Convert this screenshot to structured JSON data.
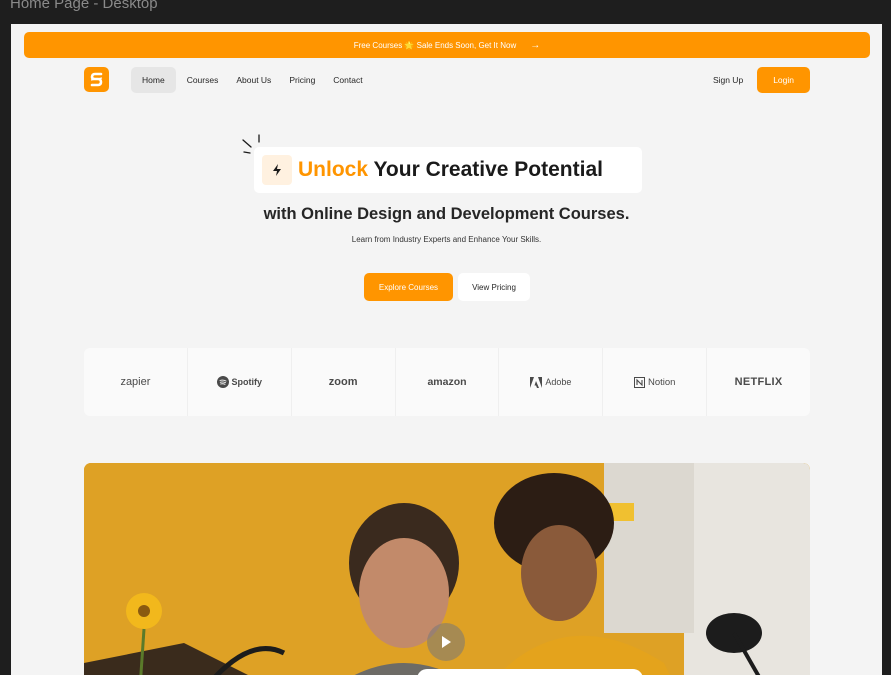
{
  "frame": {
    "title": "Home Page - Desktop"
  },
  "banner": {
    "text": "Free Courses 🌟 Sale Ends Soon, Get It Now",
    "arrow": "→"
  },
  "nav": {
    "links": [
      {
        "label": "Home",
        "active": true
      },
      {
        "label": "Courses",
        "active": false
      },
      {
        "label": "About Us",
        "active": false
      },
      {
        "label": "Pricing",
        "active": false
      },
      {
        "label": "Contact",
        "active": false
      }
    ],
    "signup": "Sign Up",
    "login": "Login"
  },
  "hero": {
    "title_accent": "Unlock",
    "title_rest": " Your Creative Potential",
    "subtitle": "with Online Design and Development Courses.",
    "tagline": "Learn from Industry Experts and Enhance Your Skills.",
    "primary_button": "Explore Courses",
    "secondary_button": "View Pricing"
  },
  "partners": [
    "zapier",
    "Spotify",
    "zoom",
    "amazon",
    "Adobe",
    "Notion",
    "NETFLIX"
  ],
  "colors": {
    "accent": "#ff9500",
    "page_bg": "#f4f4f4",
    "canvas_bg": "#1e1e1e"
  },
  "icons": {
    "logo": "s-logo-icon",
    "bolt": "lightning-icon",
    "arrow": "arrow-right-icon",
    "play": "play-icon"
  }
}
